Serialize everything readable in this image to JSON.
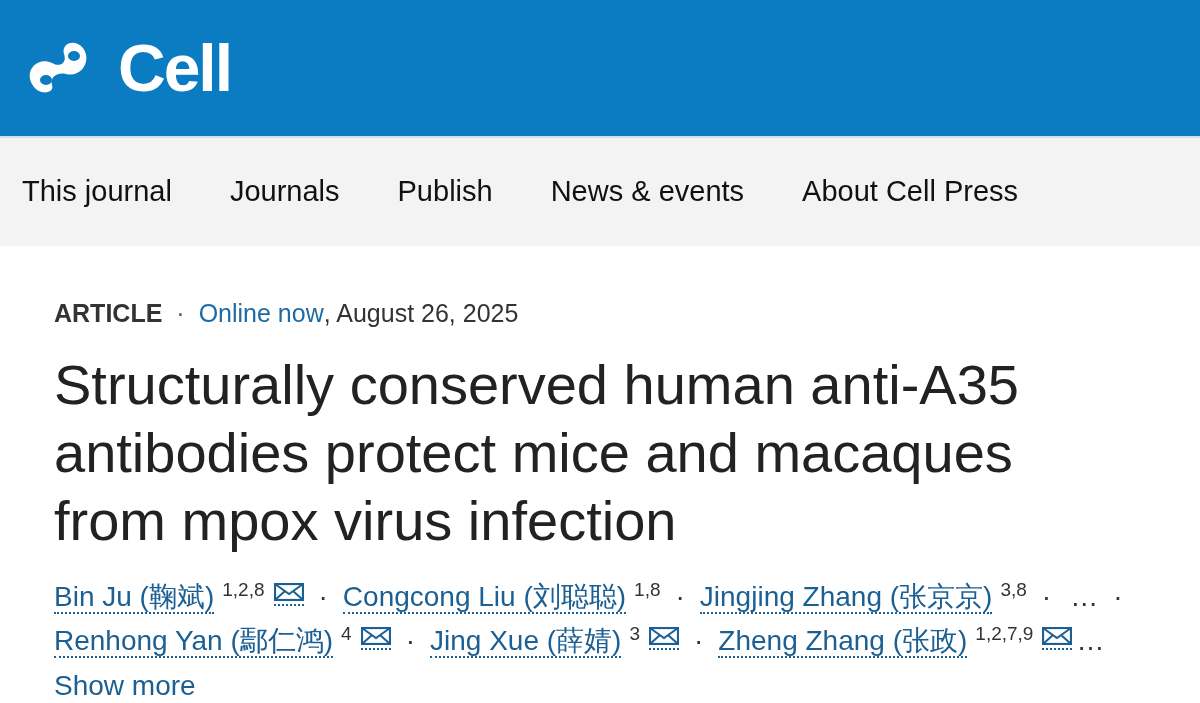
{
  "header": {
    "logo_text": "Cell"
  },
  "nav": [
    "This journal",
    "Journals",
    "Publish",
    "News & events",
    "About Cell Press"
  ],
  "article": {
    "type": "ARTICLE",
    "separator": "·",
    "status": "Online now",
    "date": ", August 26, 2025",
    "title": "Structurally conserved human anti-A35 antibodies protect mice and macaques from mpox virus infection",
    "author_rows": [
      [
        {
          "kind": "author",
          "name": "Bin Ju (鞠斌)",
          "affiliations": "1,2,8",
          "email": true
        },
        {
          "kind": "separator",
          "text": "·"
        },
        {
          "kind": "author",
          "name": "Congcong Liu (刘聪聪)",
          "affiliations": "1,8",
          "email": false
        },
        {
          "kind": "separator",
          "text": "·"
        },
        {
          "kind": "author",
          "name": "Jingjing Zhang (张京京)",
          "affiliations": "3,8",
          "email": false
        },
        {
          "kind": "separator",
          "text": "·"
        },
        {
          "kind": "ellipsis",
          "text": "…"
        },
        {
          "kind": "separator",
          "text": "·"
        }
      ],
      [
        {
          "kind": "author",
          "name": "Renhong Yan (鄢仁鸿)",
          "affiliations": "4",
          "email": true
        },
        {
          "kind": "separator",
          "text": "·"
        },
        {
          "kind": "author",
          "name": "Jing Xue (薛婧)",
          "affiliations": "3",
          "email": true
        },
        {
          "kind": "separator",
          "text": "·"
        },
        {
          "kind": "author",
          "name": "Zheng Zhang (张政)",
          "affiliations": "1,2,7,9",
          "email": true
        },
        {
          "kind": "ellipsis",
          "text": "…"
        }
      ]
    ],
    "show_more": "Show more"
  }
}
